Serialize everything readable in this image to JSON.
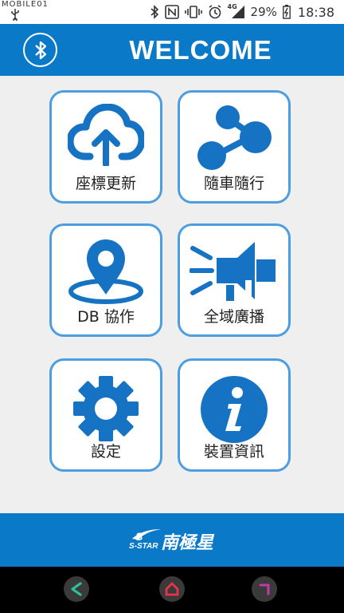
{
  "status_bar": {
    "watermark": "MOBILE01",
    "network_type": "4G",
    "battery_percent": "29%",
    "time": "18:38"
  },
  "header": {
    "title": "WELCOME",
    "bluetooth_icon": "bluetooth-icon"
  },
  "tiles": [
    {
      "label": "座標更新",
      "icon": "cloud-upload-icon"
    },
    {
      "label": "隨車隨行",
      "icon": "share-nodes-icon"
    },
    {
      "label": "DB 協作",
      "icon": "location-pin-icon"
    },
    {
      "label": "全域廣播",
      "icon": "megaphone-icon"
    },
    {
      "label": "設定",
      "icon": "gear-icon"
    },
    {
      "label": "裝置資訊",
      "icon": "info-icon"
    }
  ],
  "footer": {
    "brand_sub": "S-STAR",
    "brand_name": "南極星"
  },
  "navbar": {
    "back_icon": "back-icon",
    "home_icon": "home-icon",
    "recent_icon": "recent-apps-icon"
  },
  "colors": {
    "primary": "#0a79c8",
    "icon": "#1673c4",
    "tile_border": "#4d9ee0",
    "background": "#efefef",
    "nav_back": "#2fbf9a",
    "nav_home": "#e8334a",
    "nav_recent": "#c03aa0"
  }
}
